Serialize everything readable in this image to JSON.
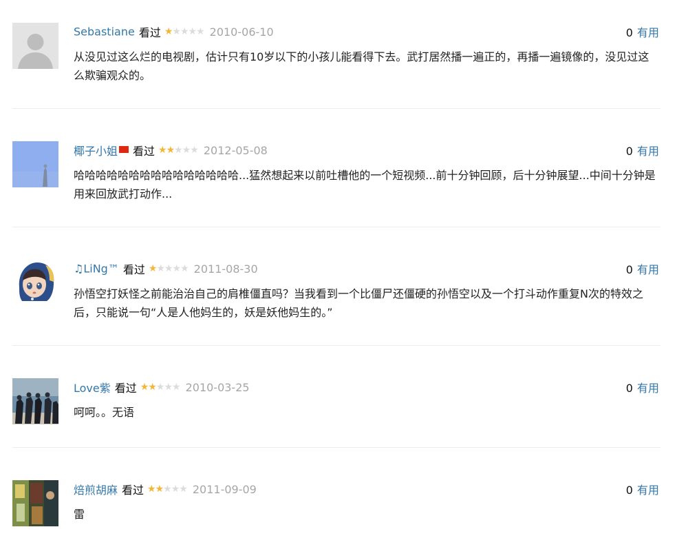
{
  "watched_label": "看过",
  "useful_label": "有用",
  "reviews": [
    {
      "user": "Sebastiane",
      "rating": 1,
      "date": "2010-06-10",
      "votes": "0",
      "text": "从没见过这么烂的电视剧，估计只有10岁以下的小孩儿能看得下去。武打居然播一遍正的，再播一遍镜像的，没见过这么欺骗观众的。",
      "avatar": "default-avatar-icon"
    },
    {
      "user": "椰子小姐",
      "rating": 2,
      "date": "2012-05-08",
      "votes": "0",
      "text": "哈哈哈哈哈哈哈哈哈哈哈哈哈哈哈...猛然想起来以前吐槽他的一个短视频...前十分钟回顾，后十分钟展望...中间十分钟是用来回放武打动作...",
      "avatar": "sky-avatar"
    },
    {
      "user": "♫LiNg™",
      "rating": 1,
      "date": "2011-08-30",
      "votes": "0",
      "text": "孙悟空打妖怪之前能治治自己的肩椎僵直吗？当我看到一个比僵尸还僵硬的孙悟空以及一个打斗动作重复N次的特效之后，只能说一句“人是人他妈生的，妖是妖他妈生的。”",
      "avatar": "doll-avatar"
    },
    {
      "user": "Love紫",
      "rating": 2,
      "date": "2010-03-25",
      "votes": "0",
      "text": "呵呵。。无语",
      "avatar": "group-photo-avatar"
    },
    {
      "user": "焙煎胡麻",
      "rating": 2,
      "date": "2011-09-09",
      "votes": "0",
      "text": "雷",
      "avatar": "poster-avatar"
    }
  ],
  "colors": {
    "link": "#3377aa",
    "star_on": "#f4b636",
    "star_off": "#dcdcdc",
    "date": "#a6a6a6"
  }
}
